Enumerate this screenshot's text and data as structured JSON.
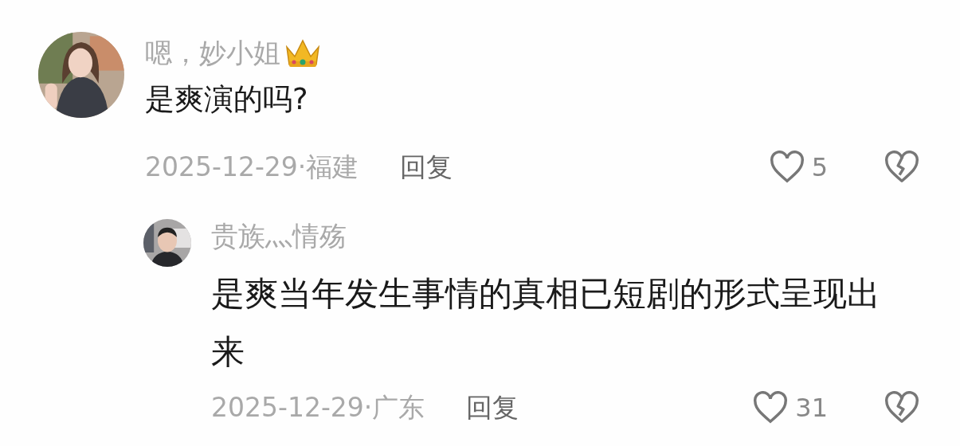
{
  "comments": [
    {
      "username": "嗯，妙小姐",
      "crowned": true,
      "content": "是爽演的吗?",
      "date_location": "2025-12-29·福建",
      "reply_label": "回复",
      "likes": "5",
      "replies": [
        {
          "username": "贵族灬情殇",
          "content": "是爽当年发生事情的真相已短剧的形式呈现出来",
          "date_location": "2025-12-29·广东",
          "reply_label": "回复",
          "likes": "31"
        }
      ]
    }
  ]
}
